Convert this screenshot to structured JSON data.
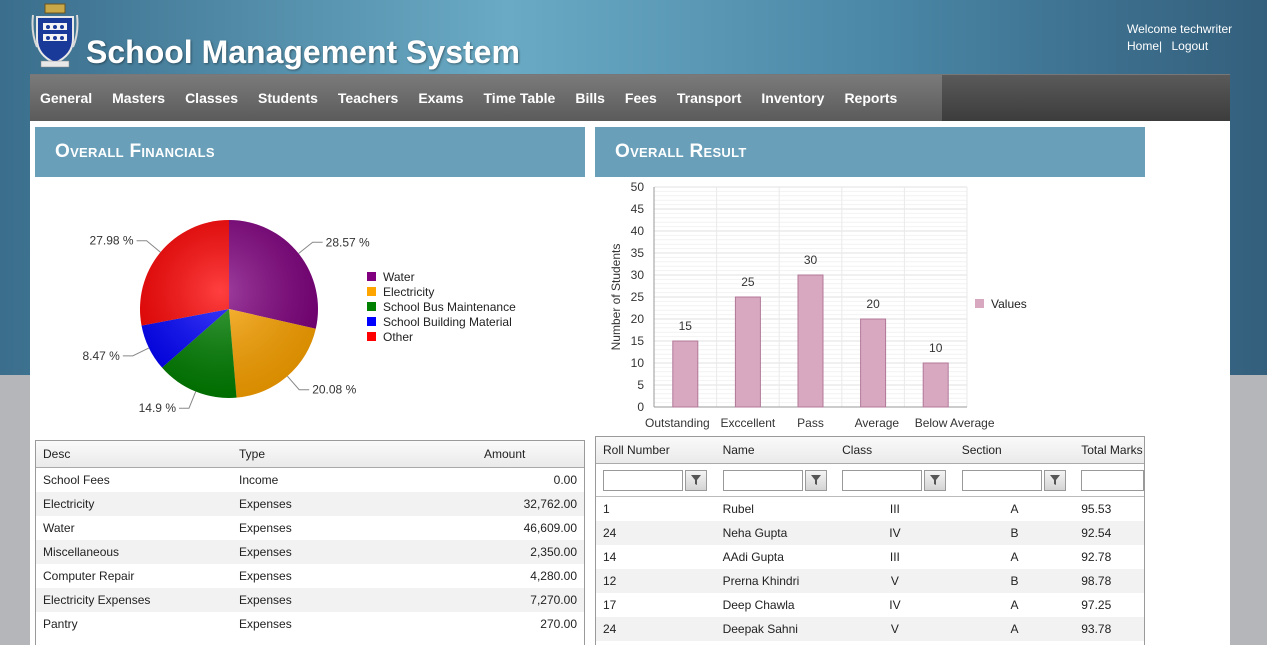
{
  "header": {
    "app_title": "School Management System",
    "welcome": "Welcome techwriter",
    "home_link": "Home",
    "separator": "|",
    "logout_link": "Logout"
  },
  "nav": {
    "items": [
      "General",
      "Masters",
      "Classes",
      "Students",
      "Teachers",
      "Exams",
      "Time Table",
      "Bills",
      "Fees",
      "Transport",
      "Inventory",
      "Reports"
    ]
  },
  "financials": {
    "title": "Overall Financials",
    "legend": [
      "Water",
      "Electricity",
      "School Bus Maintenance",
      "School Building Material",
      "Other"
    ],
    "slice_labels": [
      "28.57 %",
      "20.08 %",
      "14.9 %",
      "8.47 %",
      "27.98 %"
    ],
    "table": {
      "columns": [
        "Desc",
        "Type",
        "Amount"
      ],
      "rows": [
        [
          "School Fees",
          "Income",
          "0.00"
        ],
        [
          "Electricity",
          "Expenses",
          "32,762.00"
        ],
        [
          "Water",
          "Expenses",
          "46,609.00"
        ],
        [
          "Miscellaneous",
          "Expenses",
          "2,350.00"
        ],
        [
          "Computer Repair",
          "Expenses",
          "4,280.00"
        ],
        [
          "Electricity Expenses",
          "Expenses",
          "7,270.00"
        ],
        [
          "Pantry",
          "Expenses",
          "270.00"
        ]
      ]
    }
  },
  "result": {
    "title": "Overall Result",
    "table": {
      "columns": [
        "Roll Number",
        "Name",
        "Class",
        "Section",
        "Total Marks"
      ],
      "rows": [
        [
          "1",
          "Rubel",
          "III",
          "A",
          "95.53"
        ],
        [
          "24",
          "Neha Gupta",
          "IV",
          "B",
          "92.54"
        ],
        [
          "14",
          "AAdi Gupta",
          "III",
          "A",
          "92.78"
        ],
        [
          "12",
          "Prerna Khindri",
          "V",
          "B",
          "98.78"
        ],
        [
          "17",
          "Deep Chawla",
          "IV",
          "A",
          "97.25"
        ],
        [
          "24",
          "Deepak Sahni",
          "V",
          "A",
          "93.78"
        ]
      ]
    }
  },
  "colors": {
    "water": "#800080",
    "electricity": "#ffa500",
    "bus": "#008000",
    "building": "#0000ff",
    "other": "#ff0000",
    "bar": "#d8a8c0",
    "panel_header": "#6a9fba"
  },
  "chart_data": [
    {
      "type": "pie",
      "labels": [
        "Water",
        "Electricity",
        "School Bus Maintenance",
        "School Building Material",
        "Other"
      ],
      "values": [
        28.57,
        20.08,
        14.9,
        8.47,
        27.98
      ],
      "value_labels": [
        "28.57 %",
        "20.08 %",
        "14.9 %",
        "8.47 %",
        "27.98 %"
      ],
      "legend": "right"
    },
    {
      "type": "bar",
      "categories": [
        "Outstanding",
        "Exccellent",
        "Pass",
        "Average",
        "Below Average"
      ],
      "series": [
        {
          "name": "Values",
          "values": [
            15,
            25,
            30,
            20,
            10
          ]
        }
      ],
      "ylabel": "Number of Students",
      "ylim": [
        0,
        50
      ],
      "yticks": [
        0,
        5,
        10,
        15,
        20,
        25,
        30,
        35,
        40,
        45,
        50
      ],
      "grid": true,
      "legend": "right"
    }
  ]
}
